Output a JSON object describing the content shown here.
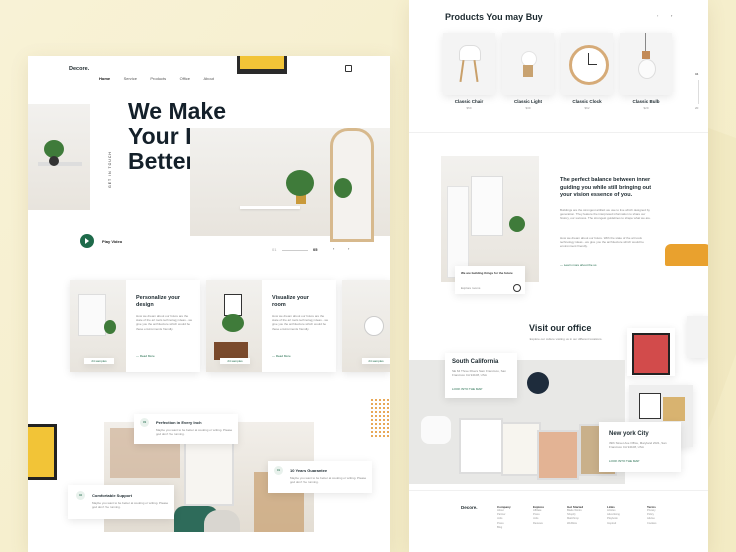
{
  "brand": {
    "logo": "Decore.",
    "accent": "#1e6a4a",
    "bg": "#f6efcf"
  },
  "nav": {
    "items": [
      "Home",
      "Service",
      "Products",
      "Office",
      "About"
    ],
    "active": "Home",
    "icons": [
      "bag-icon"
    ]
  },
  "hero": {
    "title_line1": "We Make",
    "title_line2": "Your Home",
    "title_line3": "Better",
    "vertical_text": "GET IN TOUCH",
    "play_label": "Play Video",
    "slide_current": "01",
    "slide_total": "05"
  },
  "cards": [
    {
      "title_line1": "Personalize your",
      "title_line2": "design",
      "body": "How we dream about our future are the state of the art tools technology ideas - we give you the architecture which would be these environments friendly.",
      "link": "Read More",
      "badge": "24 samples"
    },
    {
      "title_line1": "Visualize your",
      "title_line2": "room",
      "body": "How we dream about our future are the state of the art tools technology ideas - we give you the architecture which would be these environments friendly.",
      "link": "Read More",
      "badge": "24 samples"
    },
    {
      "badge": "24 samples"
    }
  ],
  "features": [
    {
      "num": "03",
      "title": "Perfection in Every Inch",
      "body": "Maybe you want to be better at cooking or writing. Please god don't 'be running."
    },
    {
      "num": "01",
      "title": "10 Years Guarantee",
      "body": "Maybe you want to be better at cooking or writing. Please god don't 'be running."
    },
    {
      "num": "02",
      "title": "Comfortable Support",
      "body": "Maybe you want to be better at cooking or writing. Please god don't 'be running."
    }
  ],
  "products": {
    "heading": "Products You may Buy",
    "items": [
      {
        "name": "Classic Chair",
        "price": "$59"
      },
      {
        "name": "Classic Light",
        "price": "$39"
      },
      {
        "name": "Classic Clock",
        "price": "$62"
      },
      {
        "name": "Classic Bulb",
        "price": "$29"
      }
    ],
    "pager_current": "04",
    "pager_total": "20"
  },
  "balance": {
    "heading_line1": "The perfect balance between inner",
    "heading_line2": "guiding you while still bringing out",
    "heading_line3": "your vision essence of you.",
    "body1": "Buildings are the strongest artifact we use to live which designed by generation. They feature the interpreted information to share our history, our success. The strongest guidelines to shape what we are.",
    "body2": "How we dream about our future. With the state of the art tools technology ideas - we give you the architecture which would be environment friendly.",
    "link": "Learn more ahout the us",
    "caption": "We are building things for the future",
    "caption_link": "Explore rooms"
  },
  "office": {
    "heading": "Visit our office",
    "sub": "Explore our culture visiting us in our different locations.",
    "loc1_name": "South California",
    "loc1_addr": "SE 64 Three Rivers Sam Francisco, San Francisco CA 94108, USA",
    "loc1_link": "LOOK INTO THE MAP",
    "loc2_name": "New york City",
    "loc2_addr": "39th Street Ave Office, Maryland 2021, San Francisco CA 94108, USA",
    "loc2_link": "LOOK INTO THE MAP"
  },
  "footer": {
    "logo": "Decore.",
    "cols": [
      {
        "head": "Company",
        "items": [
          "About",
          "Partner",
          "Jobs",
          "Press",
          "Blog"
        ]
      },
      {
        "head": "Explore",
        "items": [
          "Affiliate",
          "Press",
          "Jobs",
          "Reviews"
        ]
      },
      {
        "head": "Get Started",
        "items": [
          "Blade Works",
          "Shopify",
          "Mailchimp",
          "Webflow"
        ]
      },
      {
        "head": "Links",
        "items": [
          "Articles",
          "Advertising",
          "Playbook",
          "Inspired"
        ]
      },
      {
        "head": "Terms",
        "items": [
          "Privacy",
          "Policy",
          "Advise",
          "Cookies"
        ]
      }
    ]
  }
}
